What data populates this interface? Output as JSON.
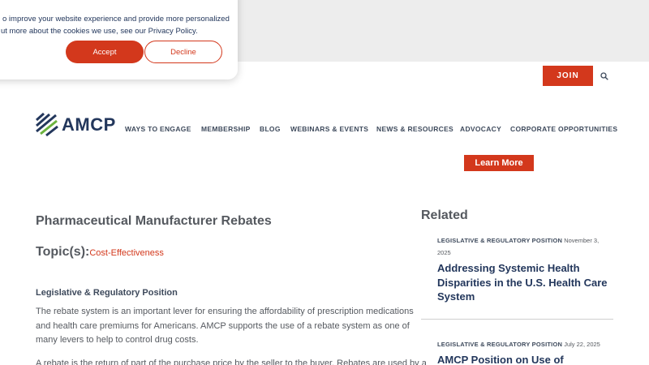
{
  "cookie": {
    "line1": "o improve your website experience and provide more personalized",
    "line2": "ut more about the cookies we use, see our Privacy Policy.",
    "accept": "Accept",
    "decline": "Decline"
  },
  "header": {
    "join": "JOIN",
    "search_icon": "search-icon",
    "logo_text": "AMCP",
    "nav": [
      "WAYS TO ENGAGE",
      "MEMBERSHIP",
      "BLOG",
      "WEBINARS & EVENTS",
      "NEWS & RESOURCES",
      "ADVOCACY",
      "CORPORATE OPPORTUNITIES"
    ],
    "learn_more": "Learn More"
  },
  "article": {
    "title": "Pharmaceutical Manufacturer Rebates",
    "topics_label": "Topic(s):",
    "topic": "Cost-Effectiveness",
    "subhead": "Legislative & Regulatory Position",
    "para1": "The rebate system is an important lever for ensuring the affordability of prescription medications and health care premiums for Americans. AMCP supports the use of a rebate system as one of many levers to help to control drug costs.",
    "para2": "A rebate is the return of part of the purchase price by the seller to the buyer. Rebates are used by a"
  },
  "related": {
    "heading": "Related",
    "items": [
      {
        "category": "LEGISLATIVE & REGULATORY POSITION",
        "date": "November 3, 2025",
        "title": "Addressing Systemic Health Disparities in the U.S. Health Care System"
      },
      {
        "category": "LEGISLATIVE & REGULATORY POSITION",
        "date": "July 22, 2025",
        "title": "AMCP Position on Use of"
      }
    ]
  },
  "colors": {
    "accent": "#d3381c",
    "navy": "#23375c",
    "text": "#55595f"
  }
}
